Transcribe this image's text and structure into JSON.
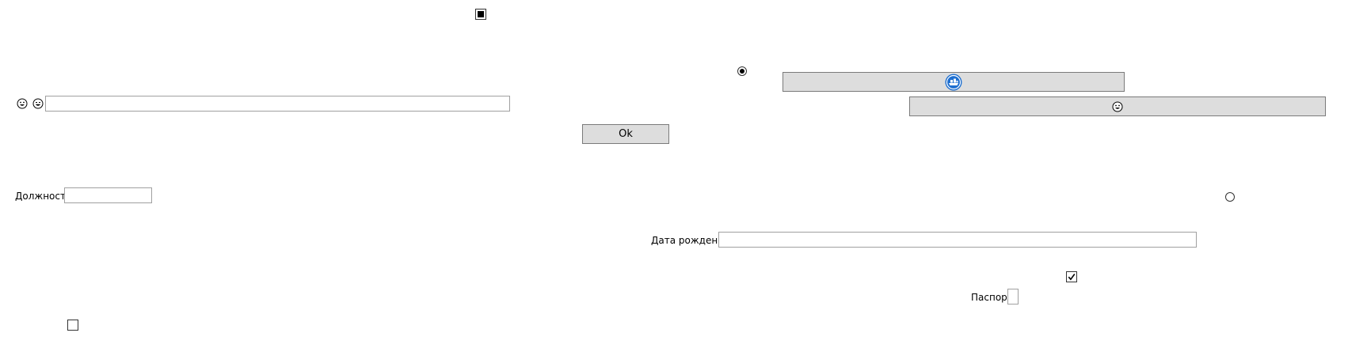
{
  "labels": {
    "position": "Должность",
    "birth_date": "Дата рождения",
    "passport": "Паспорт"
  },
  "fields": {
    "top_text": "",
    "position": "",
    "birth_date": "",
    "passport": ""
  },
  "buttons": {
    "ok": "Ok"
  },
  "checkboxes": {
    "top": "indeterminate",
    "middle_right": "checked",
    "bottom_left": "unchecked"
  },
  "radios": {
    "top": "selected",
    "right": "unselected"
  },
  "icons": {
    "emoji_1": "grinning-face-icon",
    "emoji_2": "smiling-face-icon",
    "blue_button_icon": "ship-logo-icon",
    "emoji_button_icon": "grinning-face-icon"
  }
}
